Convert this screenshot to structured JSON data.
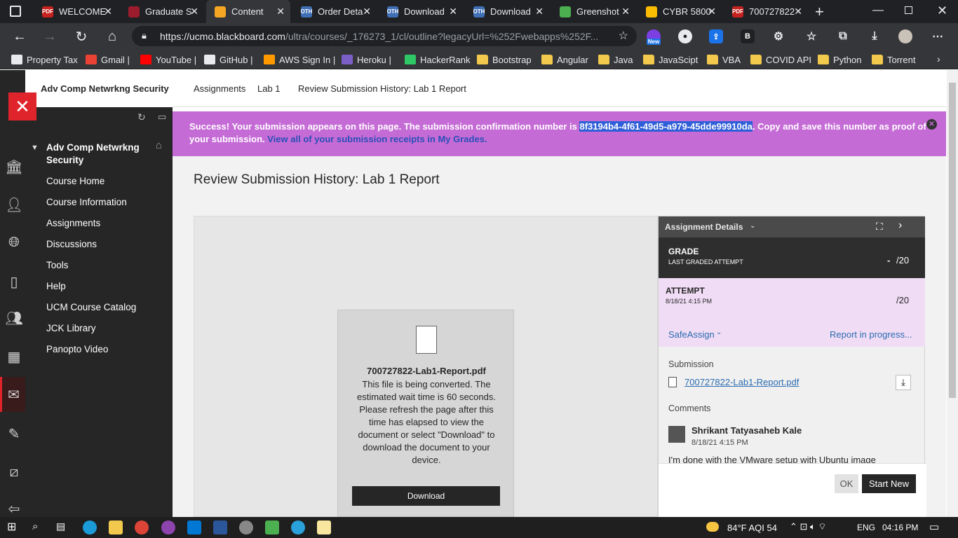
{
  "tabs": [
    {
      "title": "WELCOME",
      "icon": "pdf-icon",
      "color": "#c5221f",
      "fav": "PDF"
    },
    {
      "title": "Graduate S",
      "icon": "ucm-icon",
      "color": "#9b1c2c",
      "fav": ""
    },
    {
      "title": "Content",
      "icon": "pencil-icon",
      "color": "#f5a623",
      "fav": ""
    },
    {
      "title": "Order Deta",
      "icon": "chegg-icon",
      "color": "#3f6fb5",
      "fav": "OTH"
    },
    {
      "title": "Download",
      "icon": "chegg-icon",
      "color": "#3f6fb5",
      "fav": "OTH"
    },
    {
      "title": "Download",
      "icon": "chegg-icon",
      "color": "#3f6fb5",
      "fav": "OTH"
    },
    {
      "title": "Greenshot",
      "icon": "greenshot-icon",
      "color": "#4caf50",
      "fav": ""
    },
    {
      "title": "CYBR 5800",
      "icon": "drive-icon",
      "color": "#fbbc04",
      "fav": ""
    },
    {
      "title": "700727822",
      "icon": "pdf-icon",
      "color": "#c5221f",
      "fav": "PDF"
    }
  ],
  "address": {
    "domain": "https://ucmo.blackboard.com",
    "path": "/ultra/courses/_176273_1/cl/outline?legacyUrl=%252Fwebapps%252F..."
  },
  "bookmarks": [
    {
      "label": "Property Tax",
      "type": "page"
    },
    {
      "label": "Gmail |",
      "type": "gmail"
    },
    {
      "label": "YouTube |",
      "type": "youtube"
    },
    {
      "label": "GitHub |",
      "type": "github"
    },
    {
      "label": "AWS Sign In |",
      "type": "aws"
    },
    {
      "label": "Heroku |",
      "type": "heroku"
    },
    {
      "label": "HackerRank",
      "type": "hackerrank"
    },
    {
      "label": "Bootstrap",
      "type": "folder"
    },
    {
      "label": "Angular",
      "type": "folder"
    },
    {
      "label": "Java",
      "type": "folder"
    },
    {
      "label": "JavaScipt",
      "type": "folder"
    },
    {
      "label": "VBA",
      "type": "folder"
    },
    {
      "label": "COVID API",
      "type": "folder"
    },
    {
      "label": "Python",
      "type": "folder"
    },
    {
      "label": "Torrent",
      "type": "folder"
    }
  ],
  "ext_new_badge": "New",
  "course": {
    "short_title": "Adv Comp Netwrkng Security",
    "menu_title_line1": "Adv Comp Netwrkng",
    "menu_title_line2": "Security",
    "menu": [
      "Course Home",
      "Course Information",
      "Assignments",
      "Discussions",
      "Tools",
      "Help",
      "UCM Course Catalog",
      "JCK Library",
      "Panopto Video"
    ]
  },
  "breadcrumb": [
    "Assignments",
    "Lab 1",
    "Review Submission History: Lab 1 Report"
  ],
  "banner": {
    "pre": "Success! Your submission appears on this page. The submission confirmation number is ",
    "code": "8f3194b4-4f61-49d5-a979-45dde99910da",
    "post": ". Copy and save this number as proof of your submission. ",
    "link": "View all of your submission receipts in My Grades."
  },
  "page_title": "Review Submission History: Lab 1 Report",
  "file": {
    "name": "700727822-Lab1-Report.pdf",
    "message": "This file is being converted. The estimated wait time is 60 seconds. Please refresh the page after this time has elapsed to view the document or select \"Download\" to download the document to your device.",
    "download_label": "Download"
  },
  "panel": {
    "header": "Assignment Details",
    "grade_label": "GRADE",
    "grade_sub": "LAST GRADED ATTEMPT",
    "grade_value": "-",
    "grade_total": "/20",
    "attempt_label": "ATTEMPT",
    "attempt_date": "8/18/21 4:15 PM",
    "attempt_total": "/20",
    "safeassign": "SafeAssign",
    "report_status": "Report in progress...",
    "submission_label": "Submission",
    "submission_file": "700727822-Lab1-Report.pdf",
    "comments_label": "Comments",
    "commenter": "Shrikant Tatyasaheb Kale",
    "comment_date": "8/18/21 4:15 PM",
    "comment_text": "I'm done with the VMware setup with Ubuntu image",
    "ok_label": "OK",
    "start_new_label": "Start New"
  },
  "taskbar": {
    "weather": "84°F AQI 54",
    "lang": "ENG",
    "time": "04:16 PM"
  }
}
